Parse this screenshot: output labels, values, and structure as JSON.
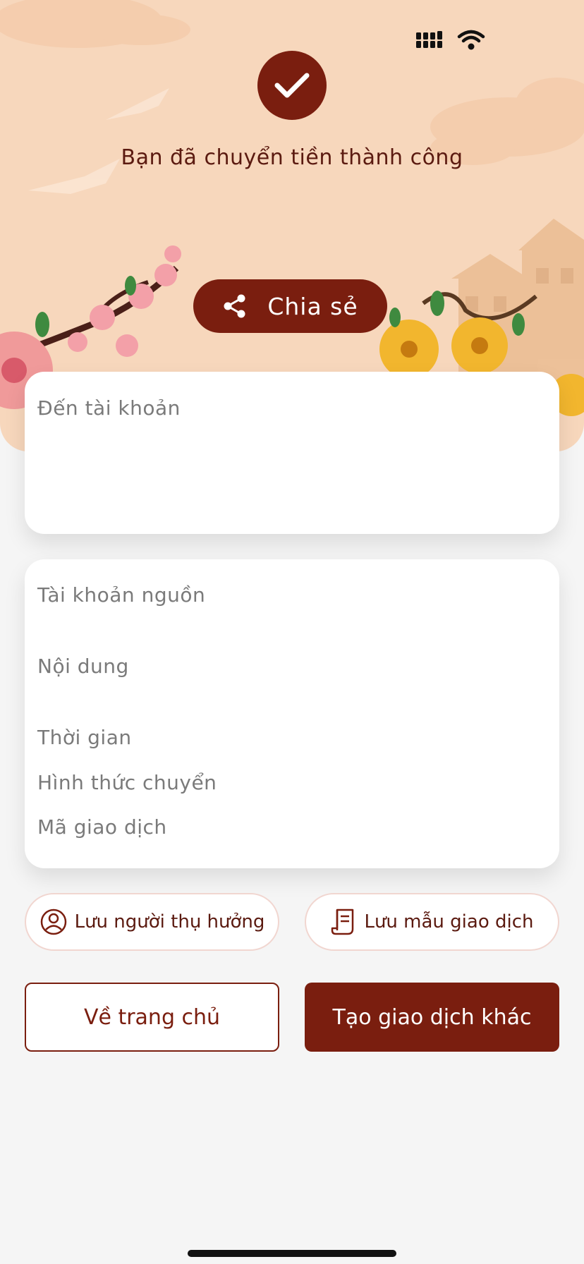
{
  "header": {
    "success_message": "Bạn đã chuyển tiền thành công",
    "share_label": "Chia sẻ"
  },
  "destination_card": {
    "to_account_label": "Đến tài khoản"
  },
  "details_card": {
    "source_account_label": "Tài khoản nguồn",
    "content_label": "Nội dung",
    "time_label": "Thời gian",
    "transfer_method_label": "Hình thức chuyển",
    "transaction_code_label": "Mã giao dịch"
  },
  "actions": {
    "save_beneficiary_label": "Lưu người thụ hưởng",
    "save_template_label": "Lưu mẫu giao dịch",
    "home_label": "Về trang chủ",
    "new_transaction_label": "Tạo giao dịch khác"
  },
  "icons": {
    "success": "check-icon",
    "share": "share-icon",
    "beneficiary": "user-circle-icon",
    "template": "receipt-icon",
    "signal": "signal-icon",
    "wifi": "wifi-icon"
  },
  "colors": {
    "brand": "#7a1e0f",
    "hero_background": "#f7d7bc",
    "label_gray": "#7a7a7a"
  }
}
